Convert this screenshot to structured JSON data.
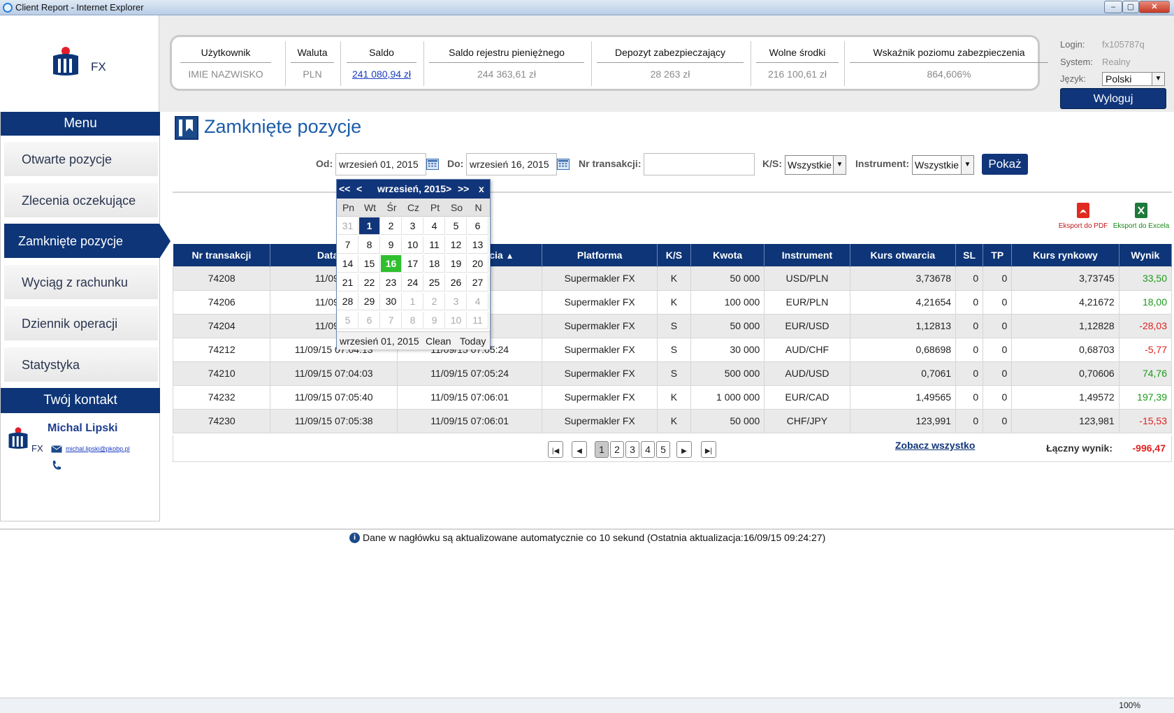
{
  "window": {
    "title": "Client Report - Internet Explorer",
    "min": "–",
    "max": "▢",
    "close": "✕"
  },
  "brand": {
    "fx": "FX"
  },
  "summary": {
    "columns": [
      {
        "label": "Użytkownik",
        "value": "IMIE NAZWISKO"
      },
      {
        "label": "Waluta",
        "value": "PLN"
      },
      {
        "label": "Saldo",
        "value": "241 080,94 zł"
      },
      {
        "label": "Saldo rejestru pieniężnego",
        "value": "244 363,61 zł"
      },
      {
        "label": "Depozyt zabezpieczający",
        "value": "28 263 zł"
      },
      {
        "label": "Wolne środki",
        "value": "216 100,61 zł"
      },
      {
        "label": "Wskaźnik poziomu zabezpieczenia",
        "value": "864,606%"
      }
    ]
  },
  "account": {
    "login_label": "Login:",
    "login_value": "fx105787q",
    "system_label": "System:",
    "system_value": "Realny",
    "lang_label": "Język:",
    "lang_value": "Polski",
    "logout": "Wyloguj"
  },
  "sidebar": {
    "menu_title": "Menu",
    "items": [
      {
        "label": "Otwarte pozycje"
      },
      {
        "label": "Zlecenia oczekujące"
      },
      {
        "label": "Zamknięte pozycje"
      },
      {
        "label": "Wyciąg z rachunku"
      },
      {
        "label": "Dziennik operacji"
      },
      {
        "label": "Statystyka"
      }
    ],
    "contact_title": "Twój kontakt",
    "contact_name": "Michal Lipski",
    "contact_email": "michal.lipski@pkobp.pl"
  },
  "page": {
    "title": "Zamknięte pozycje"
  },
  "filters": {
    "from_label": "Od:",
    "from_value": "wrzesień 01, 2015",
    "to_label": "Do:",
    "to_value": "wrzesień 16, 2015",
    "trans_label": "Nr transakcji:",
    "trans_value": "",
    "ks_label": "K/S:",
    "ks_value": "Wszystkie",
    "instr_label": "Instrument:",
    "instr_value": "Wszystkie",
    "show": "Pokaż"
  },
  "export": {
    "pdf": "Eksport do PDF",
    "excel": "Eksport do Excela"
  },
  "table": {
    "headers": [
      "Nr transakcji",
      "Data otwarcia",
      "Data zamknięcia",
      "Platforma",
      "K/S",
      "Kwota",
      "Instrument",
      "Kurs otwarcia",
      "SL",
      "TP",
      "Kurs rynkowy",
      "Wynik"
    ],
    "visible_headers": [
      "Nr transakcji",
      "Data ot",
      "cia",
      "Platforma",
      "K/S",
      "Kwota",
      "Instrument",
      "Kurs otwarcia",
      "SL",
      "TP",
      "Kurs rynkowy",
      "Wynik"
    ],
    "rows": [
      {
        "nr": "74208",
        "open": "11/09/15",
        "close": "5:23",
        "platform": "Supermakler FX",
        "ks": "K",
        "amount": "50 000",
        "instrument": "USD/PLN",
        "open_rate": "3,73678",
        "sl": "0",
        "tp": "0",
        "market_rate": "3,73745",
        "result": "33,50",
        "sign": "pos"
      },
      {
        "nr": "74206",
        "open": "11/09/15",
        "close": "5:23",
        "platform": "Supermakler FX",
        "ks": "K",
        "amount": "100 000",
        "instrument": "EUR/PLN",
        "open_rate": "4,21654",
        "sl": "0",
        "tp": "0",
        "market_rate": "4,21672",
        "result": "18,00",
        "sign": "pos"
      },
      {
        "nr": "74204",
        "open": "11/09/15",
        "close": "5:23",
        "platform": "Supermakler FX",
        "ks": "S",
        "amount": "50 000",
        "instrument": "EUR/USD",
        "open_rate": "1,12813",
        "sl": "0",
        "tp": "0",
        "market_rate": "1,12828",
        "result": "-28,03",
        "sign": "neg"
      },
      {
        "nr": "74212",
        "open": "11/09/15 07:04:13",
        "close": "11/09/15 07:05:24",
        "platform": "Supermakler FX",
        "ks": "S",
        "amount": "30 000",
        "instrument": "AUD/CHF",
        "open_rate": "0,68698",
        "sl": "0",
        "tp": "0",
        "market_rate": "0,68703",
        "result": "-5,77",
        "sign": "neg"
      },
      {
        "nr": "74210",
        "open": "11/09/15 07:04:03",
        "close": "11/09/15 07:05:24",
        "platform": "Supermakler FX",
        "ks": "S",
        "amount": "500 000",
        "instrument": "AUD/USD",
        "open_rate": "0,7061",
        "sl": "0",
        "tp": "0",
        "market_rate": "0,70606",
        "result": "74,76",
        "sign": "pos"
      },
      {
        "nr": "74232",
        "open": "11/09/15 07:05:40",
        "close": "11/09/15 07:06:01",
        "platform": "Supermakler FX",
        "ks": "K",
        "amount": "1 000 000",
        "instrument": "EUR/CAD",
        "open_rate": "1,49565",
        "sl": "0",
        "tp": "0",
        "market_rate": "1,49572",
        "result": "197,39",
        "sign": "pos"
      },
      {
        "nr": "74230",
        "open": "11/09/15 07:05:38",
        "close": "11/09/15 07:06:01",
        "platform": "Supermakler FX",
        "ks": "K",
        "amount": "50 000",
        "instrument": "CHF/JPY",
        "open_rate": "123,991",
        "sl": "0",
        "tp": "0",
        "market_rate": "123,981",
        "result": "-15,53",
        "sign": "neg"
      }
    ]
  },
  "pagination": {
    "pages": [
      "1",
      "2",
      "3",
      "4",
      "5"
    ],
    "current": "1",
    "see_all": "Zobacz wszystko",
    "total_label": "Łączny wynik:",
    "total_value": "-996,47"
  },
  "calendar": {
    "prev_year": "<<",
    "prev_month": "<",
    "month_label": "wrzesień, 2015",
    "next_month": ">",
    "next_year": ">>",
    "close": "x",
    "weekdays": [
      "Pn",
      "Wt",
      "Śr",
      "Cz",
      "Pt",
      "So",
      "N"
    ],
    "weeks": [
      [
        "31",
        "1",
        "2",
        "3",
        "4",
        "5",
        "6"
      ],
      [
        "7",
        "8",
        "9",
        "10",
        "11",
        "12",
        "13"
      ],
      [
        "14",
        "15",
        "16",
        "17",
        "18",
        "19",
        "20"
      ],
      [
        "21",
        "22",
        "23",
        "24",
        "25",
        "26",
        "27"
      ],
      [
        "28",
        "29",
        "30",
        "1",
        "2",
        "3",
        "4"
      ],
      [
        "5",
        "6",
        "7",
        "8",
        "9",
        "10",
        "11"
      ]
    ],
    "selected": "1",
    "today": "16",
    "footer_date": "wrzesień 01, 2015",
    "clean": "Clean",
    "today_label": "Today"
  },
  "note": {
    "icon": "i",
    "text": "Dane w nagłówku są aktualizowane automatycznie co 10 sekund (Ostatnia aktualizacja:16/09/15 09:24:27)"
  },
  "statusbar": {
    "zoom": "100%"
  },
  "colors": {
    "brand_navy": "#0d3577",
    "title_blue": "#1b5ca8",
    "positive": "#1a9a1a",
    "negative": "#e02020",
    "today": "#2fbf2f"
  }
}
